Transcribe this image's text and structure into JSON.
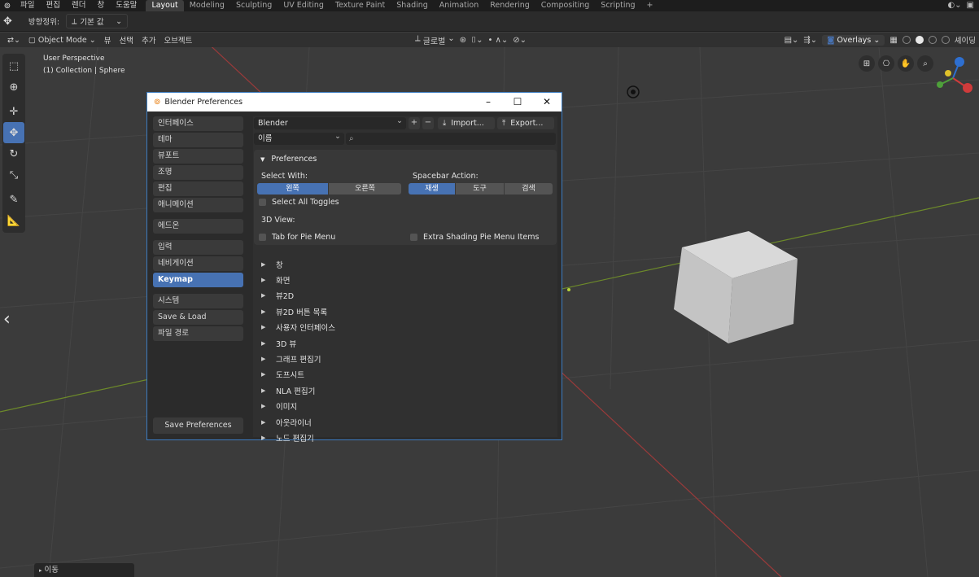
{
  "topbar": {
    "menu": [
      "파일",
      "편집",
      "렌더",
      "창",
      "도움말"
    ],
    "tabs": [
      "Layout",
      "Modeling",
      "Sculpting",
      "UV Editing",
      "Texture Paint",
      "Shading",
      "Animation",
      "Rendering",
      "Compositing",
      "Scripting"
    ],
    "active_tab": "Layout"
  },
  "toolheader": {
    "orientation_label": "방향정위:",
    "orientation_value": "기본 값"
  },
  "viewheader": {
    "mode": "Object Mode",
    "menus": [
      "뷰",
      "선택",
      "추가",
      "오브젝트"
    ],
    "transform": "글로벌",
    "overlays": "Overlays",
    "shading_label": "셰이딩"
  },
  "viewport": {
    "perspective": "User Perspective",
    "collection": "(1) Collection | Sphere",
    "last_op": "이동"
  },
  "prefs": {
    "title": "Blender Preferences",
    "sidebar_group1": [
      "인터페이스",
      "테마",
      "뷰포트",
      "조명",
      "편집",
      "애니메이션"
    ],
    "sidebar_group2": [
      "에드온"
    ],
    "sidebar_group3": [
      "입력",
      "네비게이션",
      "Keymap"
    ],
    "sidebar_group4": [
      "시스템",
      "Save & Load",
      "파일 경로"
    ],
    "active_section": "Keymap",
    "save_button": "Save Preferences",
    "keymap_preset": "Blender",
    "import_label": "Import...",
    "export_label": "Export...",
    "search_mode": "이름",
    "section_title": "Preferences",
    "select_with_label": "Select With:",
    "select_with_options": [
      "왼쪽",
      "오른쪽"
    ],
    "select_with_value": "왼쪽",
    "spacebar_label": "Spacebar Action:",
    "spacebar_options": [
      "재생",
      "도구",
      "검색"
    ],
    "spacebar_value": "재생",
    "select_all_toggles": "Select All Toggles",
    "view3d_label": "3D View:",
    "tab_pie_menu": "Tab for Pie Menu",
    "extra_shading": "Extra Shading Pie Menu Items",
    "keymap_categories": [
      "창",
      "화면",
      "뷰2D",
      "뷰2D 버튼 목록",
      "사용자 인터페이스",
      "3D 뷰",
      "그래프 편집기",
      "도프시트",
      "NLA 편집기",
      "이미지",
      "아웃라이너",
      "노드 편집기"
    ]
  },
  "colors": {
    "accent": "#4772b3",
    "window_border": "#3c7cc0"
  }
}
